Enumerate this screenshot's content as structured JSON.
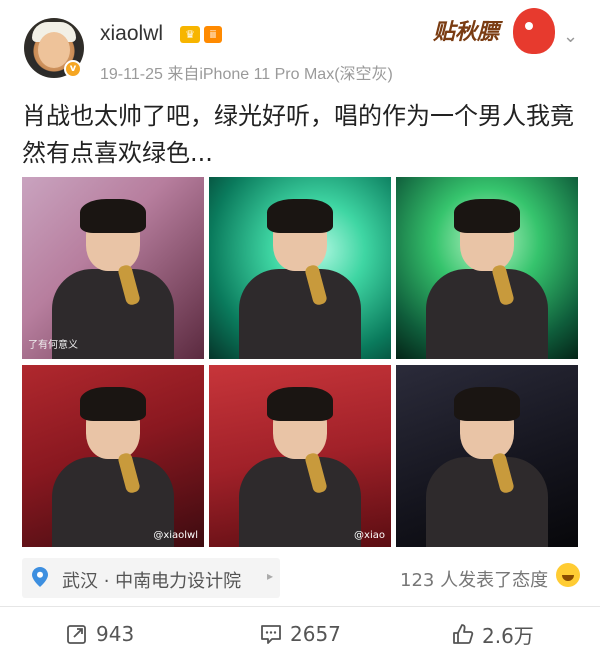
{
  "user": {
    "name": "xiaolwl",
    "badge_vip": "♛",
    "badge_level": "ⅲ"
  },
  "post": {
    "date": "19-11-25",
    "source": "来自iPhone 11 Pro Max(深空灰)",
    "text": "肖战也太帅了吧，绿光好听，唱的作为一个男人我竟然有点喜欢绿色..."
  },
  "sticker": {
    "text": "贴秋膘"
  },
  "photos": [
    {
      "caption": "了有何意义"
    },
    {
      "caption": ""
    },
    {
      "caption": ""
    },
    {
      "caption": "",
      "watermark": "@xiaolwl"
    },
    {
      "caption": "",
      "watermark": "@xiao"
    },
    {
      "caption": ""
    }
  ],
  "location": {
    "label": "武汉 · 中南电力设计院"
  },
  "reactions": {
    "text": "123 人发表了态度"
  },
  "actions": {
    "repost_count": "943",
    "comment_count": "2657",
    "like_count": "2.6万"
  },
  "colors": {
    "accent": "#f5a623",
    "text_primary": "#222222",
    "text_secondary": "#9a9a9a"
  }
}
